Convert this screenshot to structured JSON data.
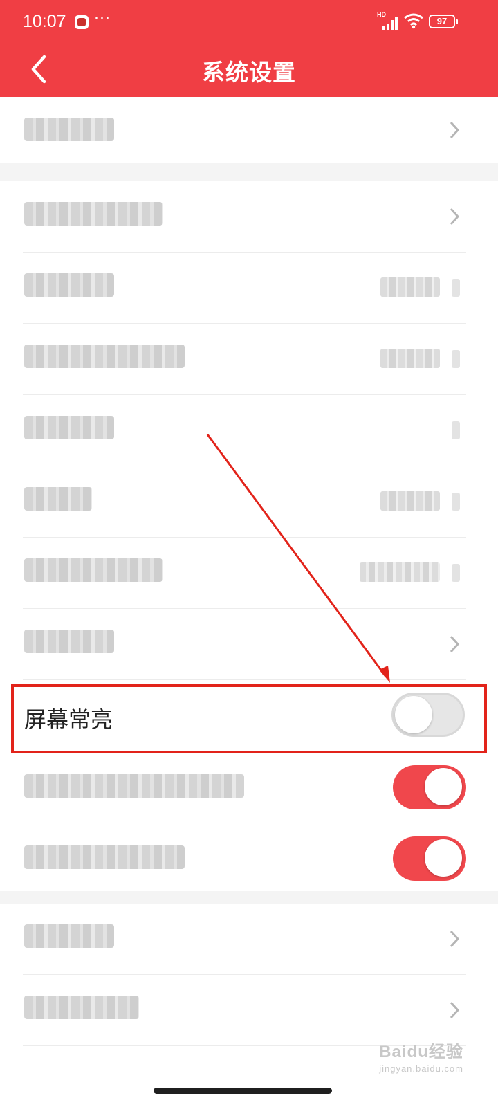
{
  "status_bar": {
    "time": "10:07",
    "dots": "···",
    "network_label": "HD",
    "battery": "97",
    "icons": [
      "app-notification-icon",
      "signal-icon",
      "wifi-icon",
      "battery-icon"
    ]
  },
  "header": {
    "title": "系统设置",
    "back_icon": "chevron-left-icon",
    "background_color": "#f03e44"
  },
  "settings": {
    "highlighted_item": {
      "label": "屏幕常亮",
      "toggle_on": false
    },
    "obscured_items_note_count": 11,
    "toggles_below": [
      {
        "toggle_on": true
      },
      {
        "toggle_on": true
      }
    ]
  },
  "annotation": {
    "highlight_color": "#e2231a"
  },
  "watermark": {
    "brand": "Baidu经验",
    "url": "jingyan.baidu.com"
  }
}
